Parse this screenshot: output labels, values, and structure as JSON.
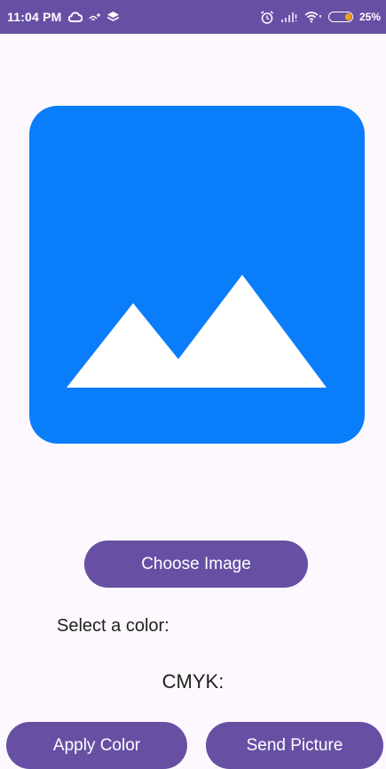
{
  "status_bar": {
    "time": "11:04 PM",
    "battery": "25%",
    "icons": [
      "cloud-icon",
      "wifi-plus-icon",
      "layers-icon",
      "alarm-icon",
      "signal-icon",
      "wifi-icon",
      "battery-icon"
    ],
    "background": "#6750a4"
  },
  "main": {
    "image_placeholder_icon": "image-icon",
    "image_placeholder_color": "#0a7dfb",
    "choose_image_label": "Choose Image",
    "select_color_label": "Select a color:",
    "cmyk_label": "CMYK:",
    "apply_color_label": "Apply Color",
    "send_picture_label": "Send Picture",
    "button_color": "#6750a4"
  }
}
